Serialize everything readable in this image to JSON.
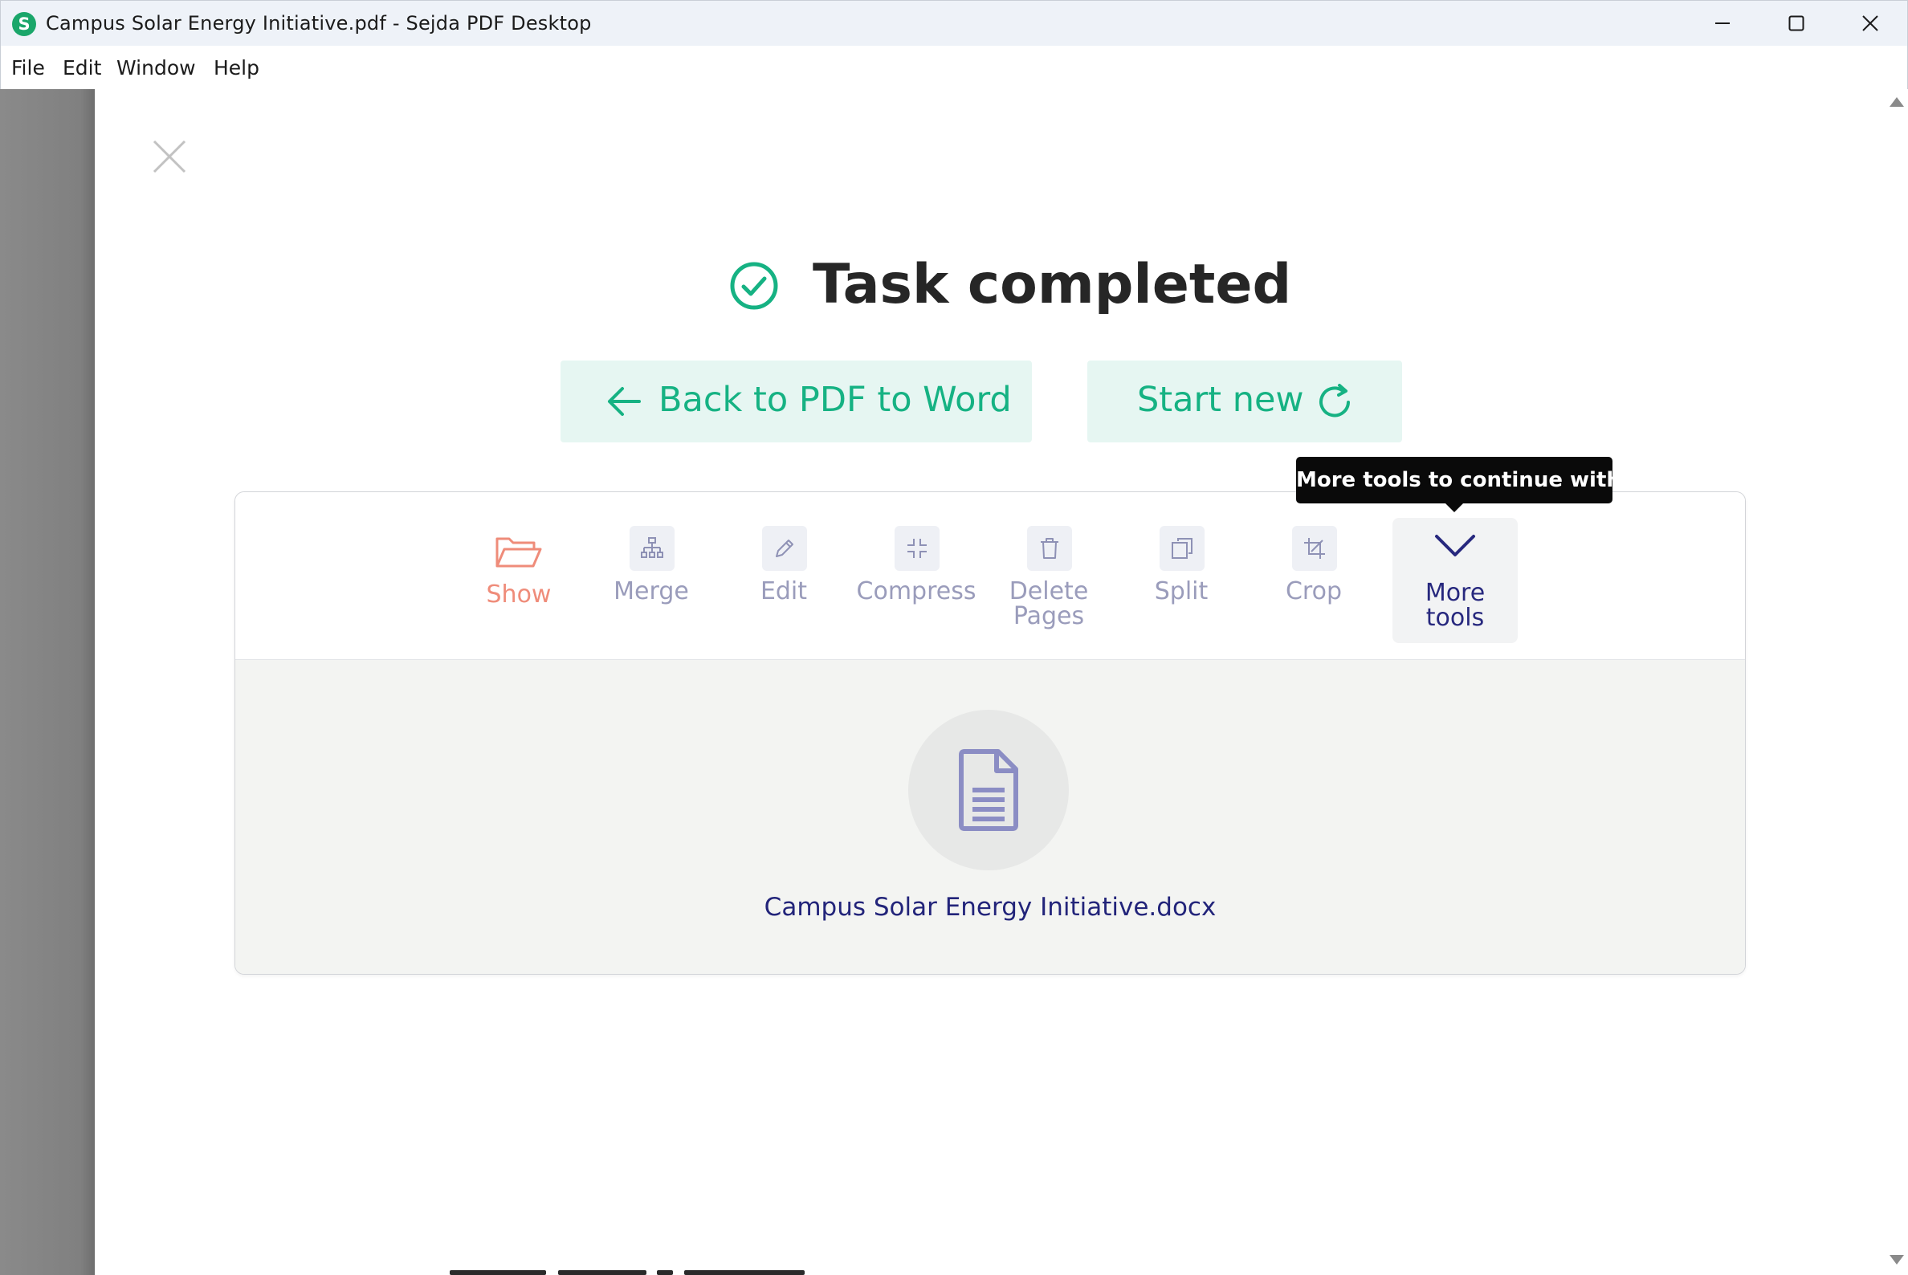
{
  "window": {
    "title": "Campus Solar Energy Initiative.pdf - Sejda PDF Desktop",
    "logo_letter": "S",
    "controls": [
      "minimize-icon",
      "maximize-icon",
      "close-icon"
    ]
  },
  "menu": {
    "items": [
      "File",
      "Edit",
      "Window",
      "Help"
    ]
  },
  "result": {
    "status_icon": "check-circle-icon",
    "title": "Task completed",
    "back_button": {
      "label": "Back to PDF to Word",
      "icon": "arrow-left-icon"
    },
    "start_new_button": {
      "label": "Start new",
      "icon": "refresh-icon"
    }
  },
  "tools": {
    "items": [
      {
        "label": "Show",
        "icon": "folder-open-icon"
      },
      {
        "label": "Merge",
        "icon": "merge-icon"
      },
      {
        "label": "Edit",
        "icon": "pencil-icon"
      },
      {
        "label": "Compress",
        "icon": "compress-icon"
      },
      {
        "label": "Delete Pages",
        "icon": "trash-icon"
      },
      {
        "label": "Split",
        "icon": "split-icon"
      },
      {
        "label": "Crop",
        "icon": "crop-icon"
      },
      {
        "label": "More tools",
        "icon": "chevron-down-icon"
      }
    ],
    "tooltip": "More tools to continue with"
  },
  "output_file": {
    "name": "Campus Solar Energy Initiative.docx",
    "icon": "document-icon"
  },
  "colors": {
    "accent_green": "#16b283",
    "button_bg": "#e6f6f2",
    "tool_label": "#9a9cbb",
    "show_label": "#ef8c7a",
    "link_navy": "#22247a"
  }
}
